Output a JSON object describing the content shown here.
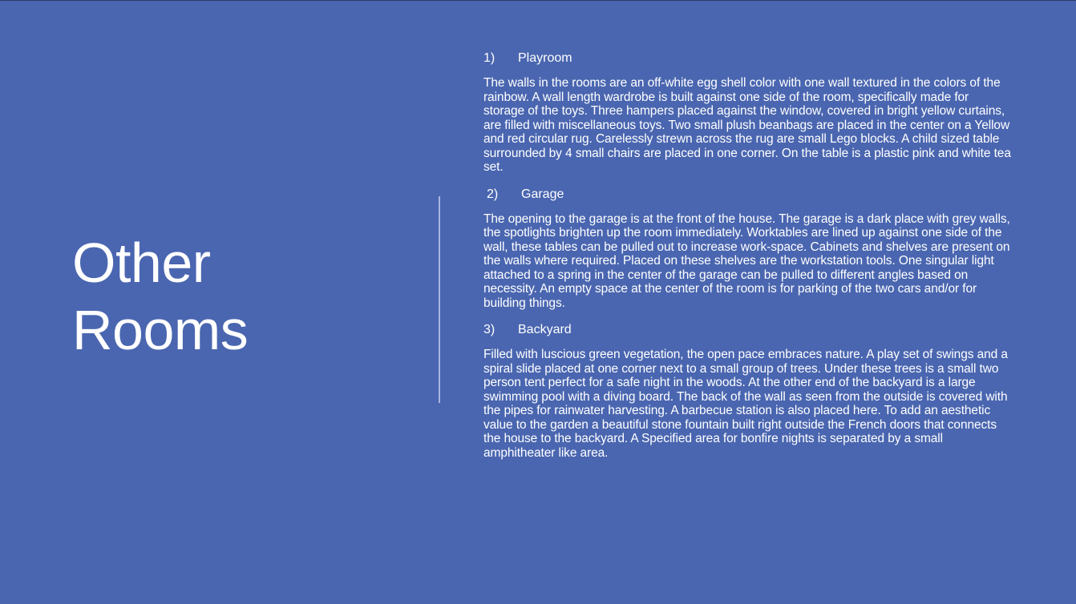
{
  "title": {
    "line1": "Other",
    "line2": "Rooms"
  },
  "sections": [
    {
      "number": "1)",
      "heading": "Playroom",
      "body": "The walls in the rooms are an off-white egg shell color with one wall textured in the colors of the rainbow. A wall length wardrobe is built against one side of the room, specifically made for storage of the toys. Three hampers placed against the window, covered in bright yellow curtains, are filled with miscellaneous toys. Two small plush beanbags are placed in the center on a Yellow and red circular rug. Carelessly strewn across the rug are small Lego blocks. A child sized table surrounded by 4 small chairs are placed in one corner. On the table is a plastic pink and white tea set."
    },
    {
      "number": "2)",
      "heading": "Garage",
      "body": "The opening to the garage is at the front of the house. The garage is a dark place with grey walls, the spotlights brighten up the room immediately. Worktables are lined up against one side of the wall, these tables can be pulled out to increase work-space. Cabinets and shelves are present on the walls where required. Placed on these shelves are the workstation tools. One singular light attached to a spring in the center of the garage can be pulled to different angles based on necessity. An empty space at the center of the room is for parking of the two cars and/or for building things."
    },
    {
      "number": "3)",
      "heading": "Backyard",
      "body": "Filled with luscious green vegetation, the open pace embraces nature. A play set of swings and a spiral slide placed at one corner next to a small group of trees. Under these trees is a small two person tent perfect for a safe night in the woods. At the other end of the backyard is a large swimming pool with a diving board. The back of the wall as seen from the outside is covered with the pipes for rainwater harvesting. A barbecue station is also placed here. To add an aesthetic value to the garden a beautiful stone fountain built right outside the French doors that connects the house to the backyard. A Specified area for bonfire nights is separated by a small amphitheater like area."
    }
  ],
  "colors": {
    "background": "#4a66b0",
    "text": "#ffffff",
    "divider": "#a8b6df"
  }
}
